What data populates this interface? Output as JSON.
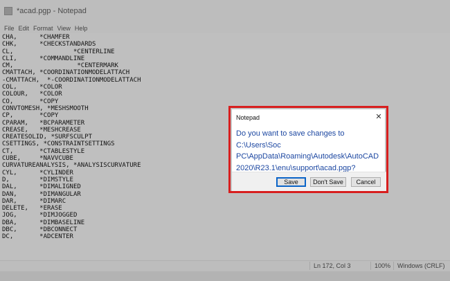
{
  "window": {
    "title": "*acad.pgp - Notepad"
  },
  "menu": [
    "File",
    "Edit",
    "Format",
    "View",
    "Help"
  ],
  "editor": {
    "lines": [
      "CHA,      *CHAMFER",
      "CHK,      *CHECKSTANDARDS",
      "CL,                *CENTERLINE",
      "CLI,      *COMMANDLINE",
      "CM,                 *CENTERMARK",
      "CMATTACH, *COORDINATIONMODELATTACH",
      "-CMATTACH,  *-COORDINATIONMODELATTACH",
      "COL,      *COLOR",
      "COLOUR,   *COLOR",
      "CO,       *COPY",
      "CONVTOMESH, *MESHSMOOTH",
      "CP,       *COPY",
      "CPARAM,   *BCPARAMETER",
      "CREASE,   *MESHCREASE",
      "CREATESOLID, *SURFSCULPT",
      "CSETTINGS, *CONSTRAINTSETTINGS",
      "CT,       *CTABLESTYLE",
      "CUBE,     *NAVVCUBE",
      "CURVATUREANALYSIS, *ANALYSISCURVATURE",
      "CYL,      *CYLINDER",
      "D,        *DIMSTYLE",
      "DAL,      *DIMALIGNED",
      "DAN,      *DIMANGULAR",
      "DAR,      *DIMARC",
      "DELETE,   *ERASE",
      "JOG,      *DIMJOGGED",
      "DBA,      *DIMBASELINE",
      "DBC,      *DBCONNECT",
      "DC,       *ADCENTER"
    ]
  },
  "status": {
    "position": "Ln 172, Col 3",
    "zoom": "100%",
    "line_ending": "Windows (CRLF)"
  },
  "dialog": {
    "title": "Notepad",
    "message": "Do you want to save changes to C:\\Users\\Soc PC\\AppData\\Roaming\\Autodesk\\AutoCAD 2020\\R23.1\\enu\\support\\acad.pgp?",
    "buttons": {
      "save": "Save",
      "dont_save": "Don't Save",
      "cancel": "Cancel"
    },
    "close_glyph": "✕"
  }
}
